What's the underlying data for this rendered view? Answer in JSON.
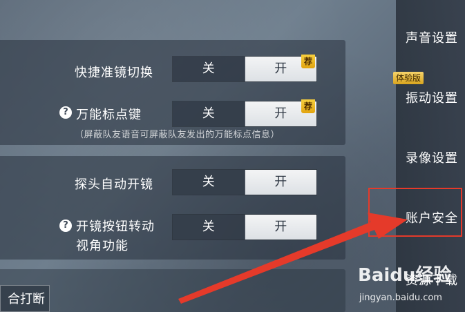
{
  "settings": {
    "row1": {
      "label": "快捷准镜切换",
      "off": "关",
      "on": "开",
      "badge": "荐"
    },
    "row2": {
      "label": "万能标点键",
      "off": "关",
      "on": "开",
      "badge": "荐",
      "help": "?",
      "note": "（屏蔽队友语音可屏蔽队友发出的万能标点信息）"
    },
    "row3": {
      "label": "探头自动开镜",
      "off": "关",
      "on": "开"
    },
    "row4": {
      "label_line1": "开镜按钮转动",
      "label_line2": "视角功能",
      "off": "关",
      "on": "开",
      "help": "?"
    },
    "partial_button": "合打断"
  },
  "sidebar": {
    "items": [
      {
        "label": "声音设置"
      },
      {
        "label": "振动设置",
        "tag": "体验版"
      },
      {
        "label": "录像设置"
      },
      {
        "label": "账户安全"
      },
      {
        "label": "资源下载"
      }
    ]
  },
  "watermark": {
    "main": "Baidu经验",
    "sub": "jingyan.baidu.com"
  },
  "colors": {
    "annotation": "#e53a2a",
    "badge": "#f0b820"
  }
}
